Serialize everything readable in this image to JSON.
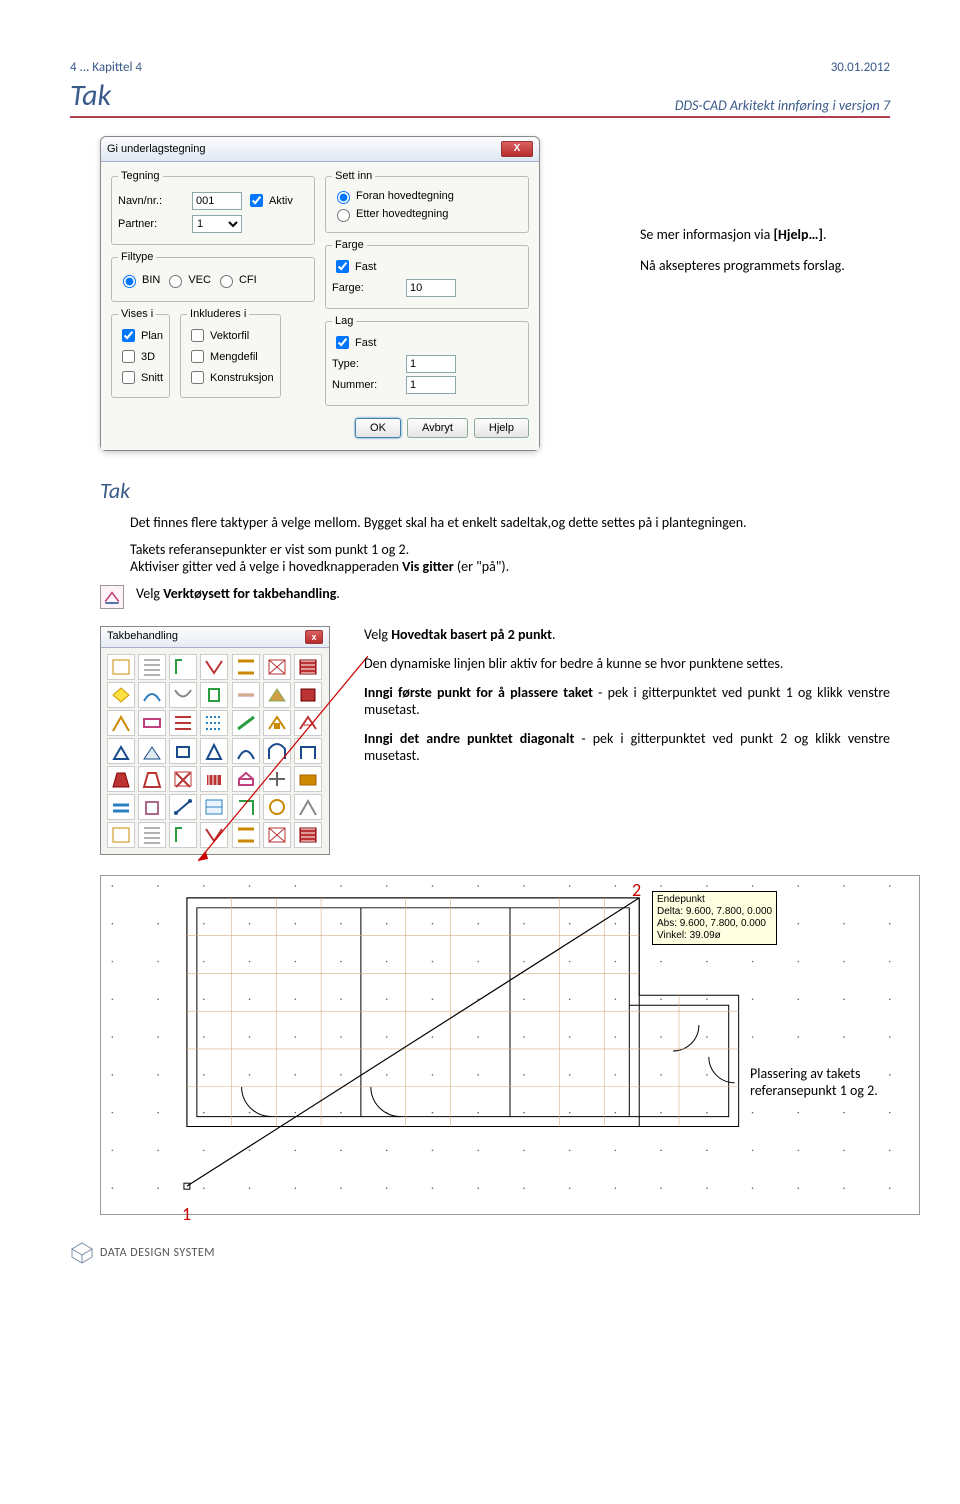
{
  "header": {
    "left": "4 ... Kapittel 4",
    "right": "30.01.2012"
  },
  "title": {
    "tak": "Tak",
    "subtitle": "DDS-CAD Arkitekt innføring i versjon 7"
  },
  "dialog": {
    "title": "Gi underlagstegning",
    "tegning_legend": "Tegning",
    "navn_label": "Navn/nr.:",
    "navn_value": "001",
    "partner_label": "Partner:",
    "partner_value": "1",
    "aktiv_label": "Aktiv",
    "filtype_legend": "Filtype",
    "bin": "BIN",
    "vec": "VEC",
    "cfi": "CFI",
    "vises_legend": "Vises i",
    "plan": "Plan",
    "d3": "3D",
    "snitt": "Snitt",
    "inkluderes_legend": "Inkluderes i",
    "vektorfil": "Vektorfil",
    "mengdefil": "Mengdefil",
    "konstruksjon": "Konstruksjon",
    "settinn_legend": "Sett inn",
    "foran": "Foran hovedtegning",
    "etter": "Etter hovedtegning",
    "farge_legend": "Farge",
    "fast1": "Fast",
    "farge_label": "Farge:",
    "farge_value": "10",
    "lag_legend": "Lag",
    "fast2": "Fast",
    "type_label": "Type:",
    "type_value": "1",
    "nummer_label": "Nummer:",
    "nummer_value": "1",
    "ok": "OK",
    "avbryt": "Avbryt",
    "hjelp": "Hjelp"
  },
  "side": {
    "p1a": "Se mer informasjon via ",
    "p1b": "[Hjelp…]",
    "p1c": ".",
    "p2": "Nå aksepteres programmets forslag."
  },
  "section": {
    "heading": "Tak",
    "p1": "Det finnes flere taktyper å velge mellom. Bygget skal ha et enkelt sadeltak,og dette settes på i plantegningen.",
    "p2a": "Takets referansepunkter er vist som punkt 1 og 2.",
    "p2b_pre": "Aktiviser gitter ved å velge i hovedknapperaden ",
    "p2b_bold": "Vis gitter",
    "p2b_post": " (er \"på\").",
    "p3a": "Velg ",
    "p3b": "Verktøysett for takbehandling",
    "p3c": "."
  },
  "palette_title": "Takbehandling",
  "palette_text": {
    "p1a": "Velg ",
    "p1b": "Hovedtak basert på 2 punkt",
    "p1c": ".",
    "p2": "Den dynamiske linjen blir aktiv for bedre å kunne se hvor punktene settes.",
    "p3a": "Inngi første punkt for å plassere taket",
    "p3b": " - pek i gitterpunktet ved punkt 1 og klikk venstre musetast.",
    "p4a": "Inngi det andre punktet diagonalt",
    "p4b": " - pek i gitterpunktet ved punkt 2 og klikk venstre musetast."
  },
  "tooltip": {
    "l1": "Endepunkt",
    "l2": "Delta: 9.600, 7.800, 0.000",
    "l3": "Abs: 9.600, 7.800, 0.000",
    "l4": "Vinkel: 39.09ø"
  },
  "markers": {
    "one": "1",
    "two": "2"
  },
  "placement": "Plassering av takets referansepunkt 1 og 2.",
  "footer": "DATA DESIGN SYSTEM"
}
